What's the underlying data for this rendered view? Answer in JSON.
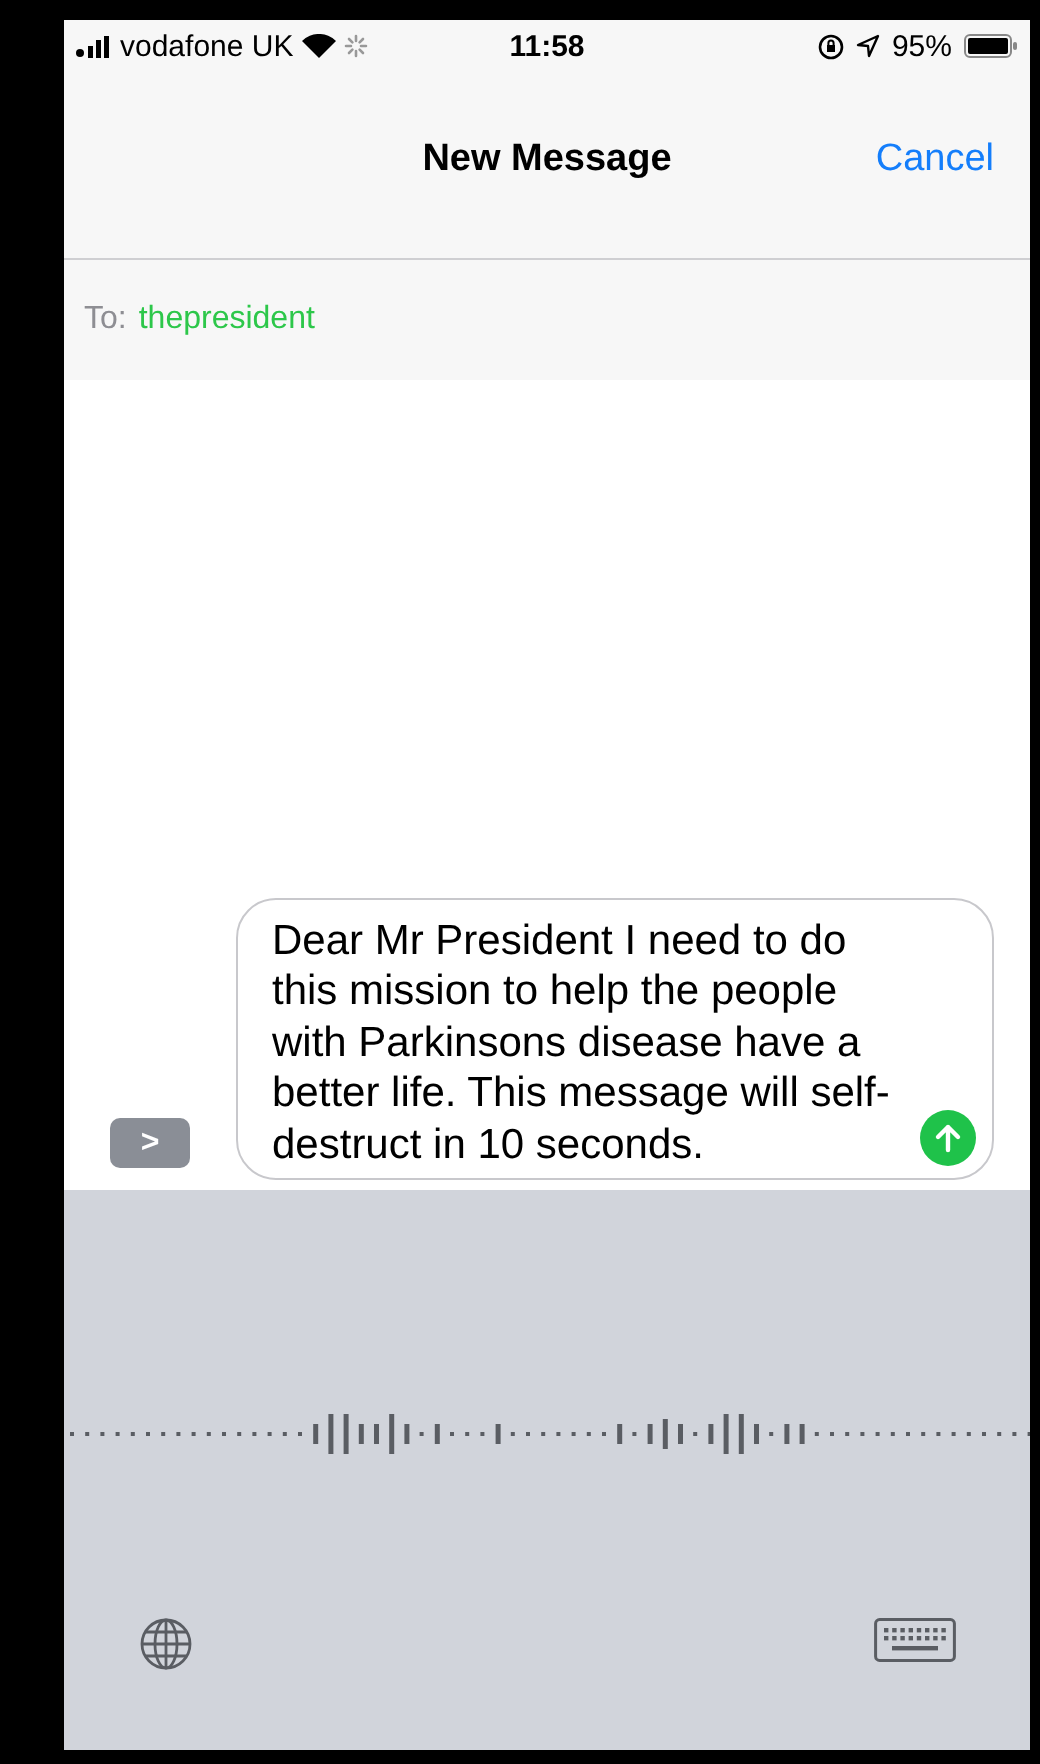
{
  "status_bar": {
    "carrier": "vodafone UK",
    "time": "11:58",
    "battery": "95%"
  },
  "nav": {
    "title": "New Message",
    "cancel": "Cancel"
  },
  "to_field": {
    "label": "To:",
    "recipient": "thepresident"
  },
  "compose": {
    "expand_button": ">",
    "message": "Dear Mr President I need to do this mission to help the people with Parkinsons disease have a better life. This message will self-destruct in 10 seconds."
  }
}
